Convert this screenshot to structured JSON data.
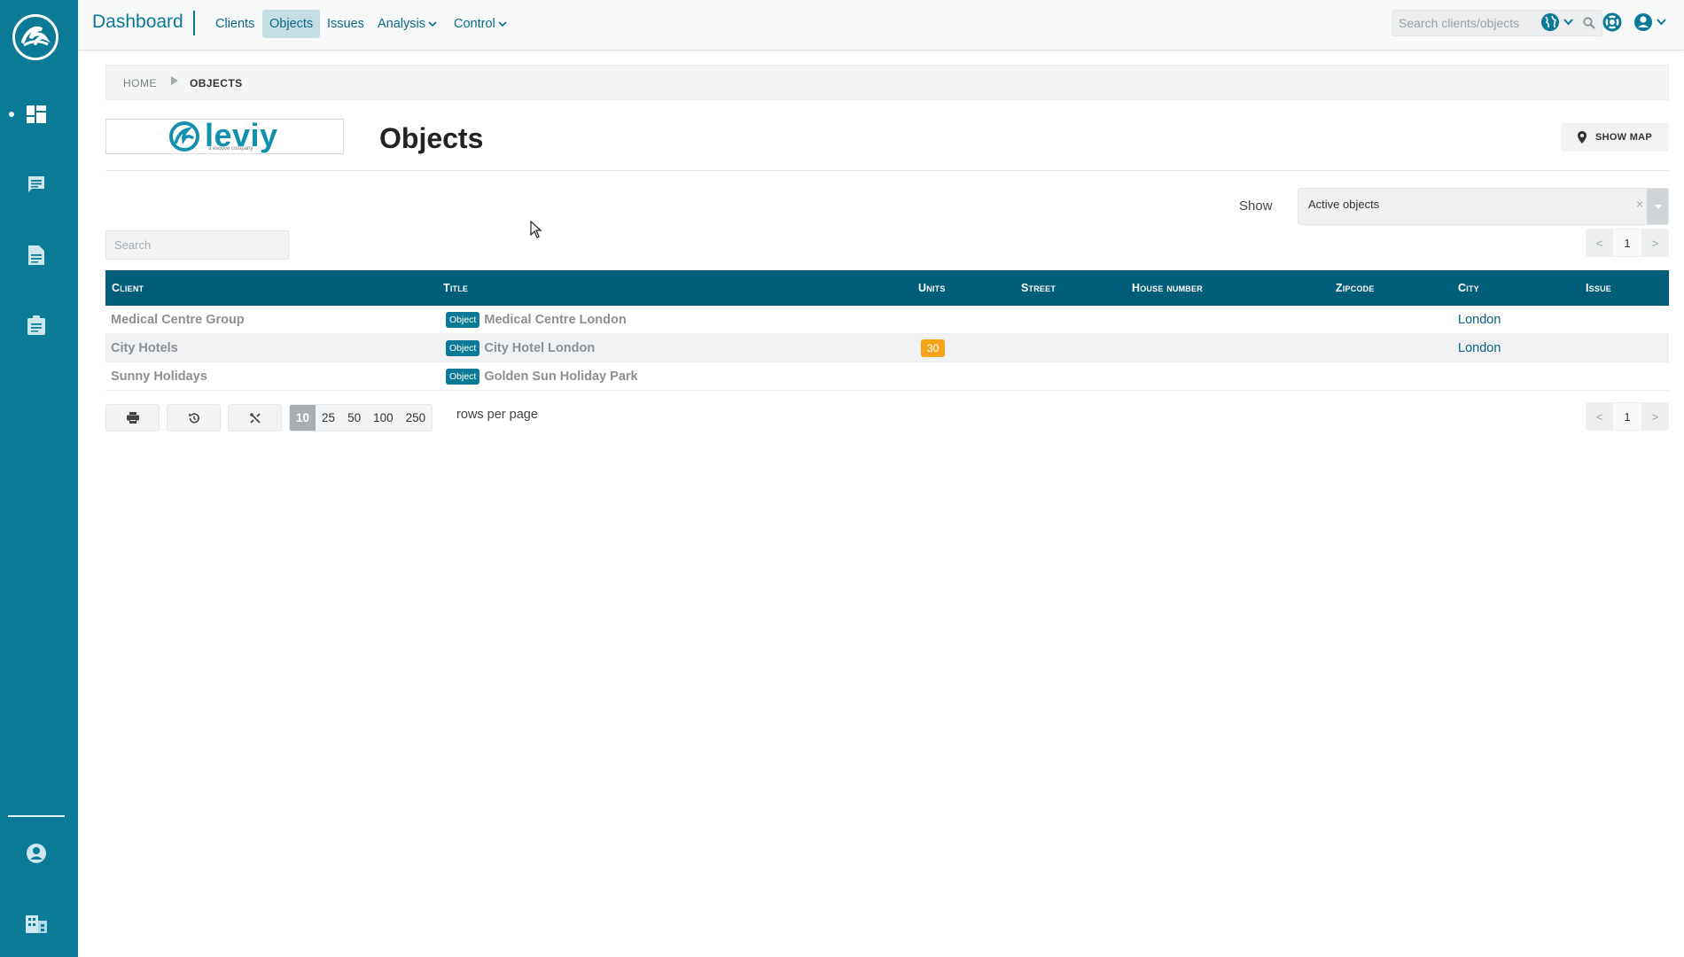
{
  "topbar": {
    "title": "Dashboard",
    "nav": [
      {
        "label": "Clients",
        "active": false
      },
      {
        "label": "Objects",
        "active": true
      },
      {
        "label": "Issues",
        "active": false
      },
      {
        "label": "Analysis",
        "dropdown": true
      },
      {
        "label": "Control",
        "dropdown": true
      }
    ],
    "search_placeholder": "Search clients/objects"
  },
  "sidebar": {
    "items": [
      {
        "icon": "dashboard-icon",
        "active": true
      },
      {
        "icon": "chat-icon"
      },
      {
        "icon": "document-icon"
      },
      {
        "icon": "clipboard-icon"
      },
      {
        "icon": "user-icon"
      },
      {
        "icon": "building-icon"
      }
    ]
  },
  "breadcrumb": {
    "home": "HOME",
    "current": "OBJECTS"
  },
  "brand": {
    "name": "leviy",
    "tagline": "a evoove company",
    "color": "#1190b0"
  },
  "page": {
    "title": "Objects",
    "show_map_label": "SHOW MAP"
  },
  "filter": {
    "show_label": "Show",
    "selected": "Active objects",
    "clear": "×"
  },
  "table_search": {
    "placeholder": "Search"
  },
  "pagination": {
    "prev": "<",
    "page": "1",
    "next": ">"
  },
  "table": {
    "columns": [
      "Client",
      "Title",
      "Units",
      "Street",
      "House number",
      "Zipcode",
      "City",
      "Issue"
    ],
    "rows": [
      {
        "client": "Medical Centre Group",
        "badge": "Object",
        "title": "Medical Centre London",
        "units": "",
        "street": "",
        "house_number": "",
        "zipcode": "",
        "city": "London",
        "issue": ""
      },
      {
        "client": "City Hotels",
        "badge": "Object",
        "title": "City Hotel London",
        "units": "30",
        "street": "",
        "house_number": "",
        "zipcode": "",
        "city": "London",
        "issue": ""
      },
      {
        "client": "Sunny Holidays",
        "badge": "Object",
        "title": "Golden Sun Holiday Park",
        "units": "",
        "street": "",
        "house_number": "",
        "zipcode": "",
        "city": "",
        "issue": ""
      }
    ]
  },
  "toolbar": {
    "buttons": [
      "print-icon",
      "history-icon",
      "tools-icon"
    ],
    "rows_options": [
      "10",
      "25",
      "50",
      "100",
      "250"
    ],
    "rows_selected": "10",
    "rows_label": "rows per page"
  },
  "colors": {
    "primary": "#0b7a97",
    "table_header": "#005e7a",
    "units_badge": "#f6a21a"
  }
}
